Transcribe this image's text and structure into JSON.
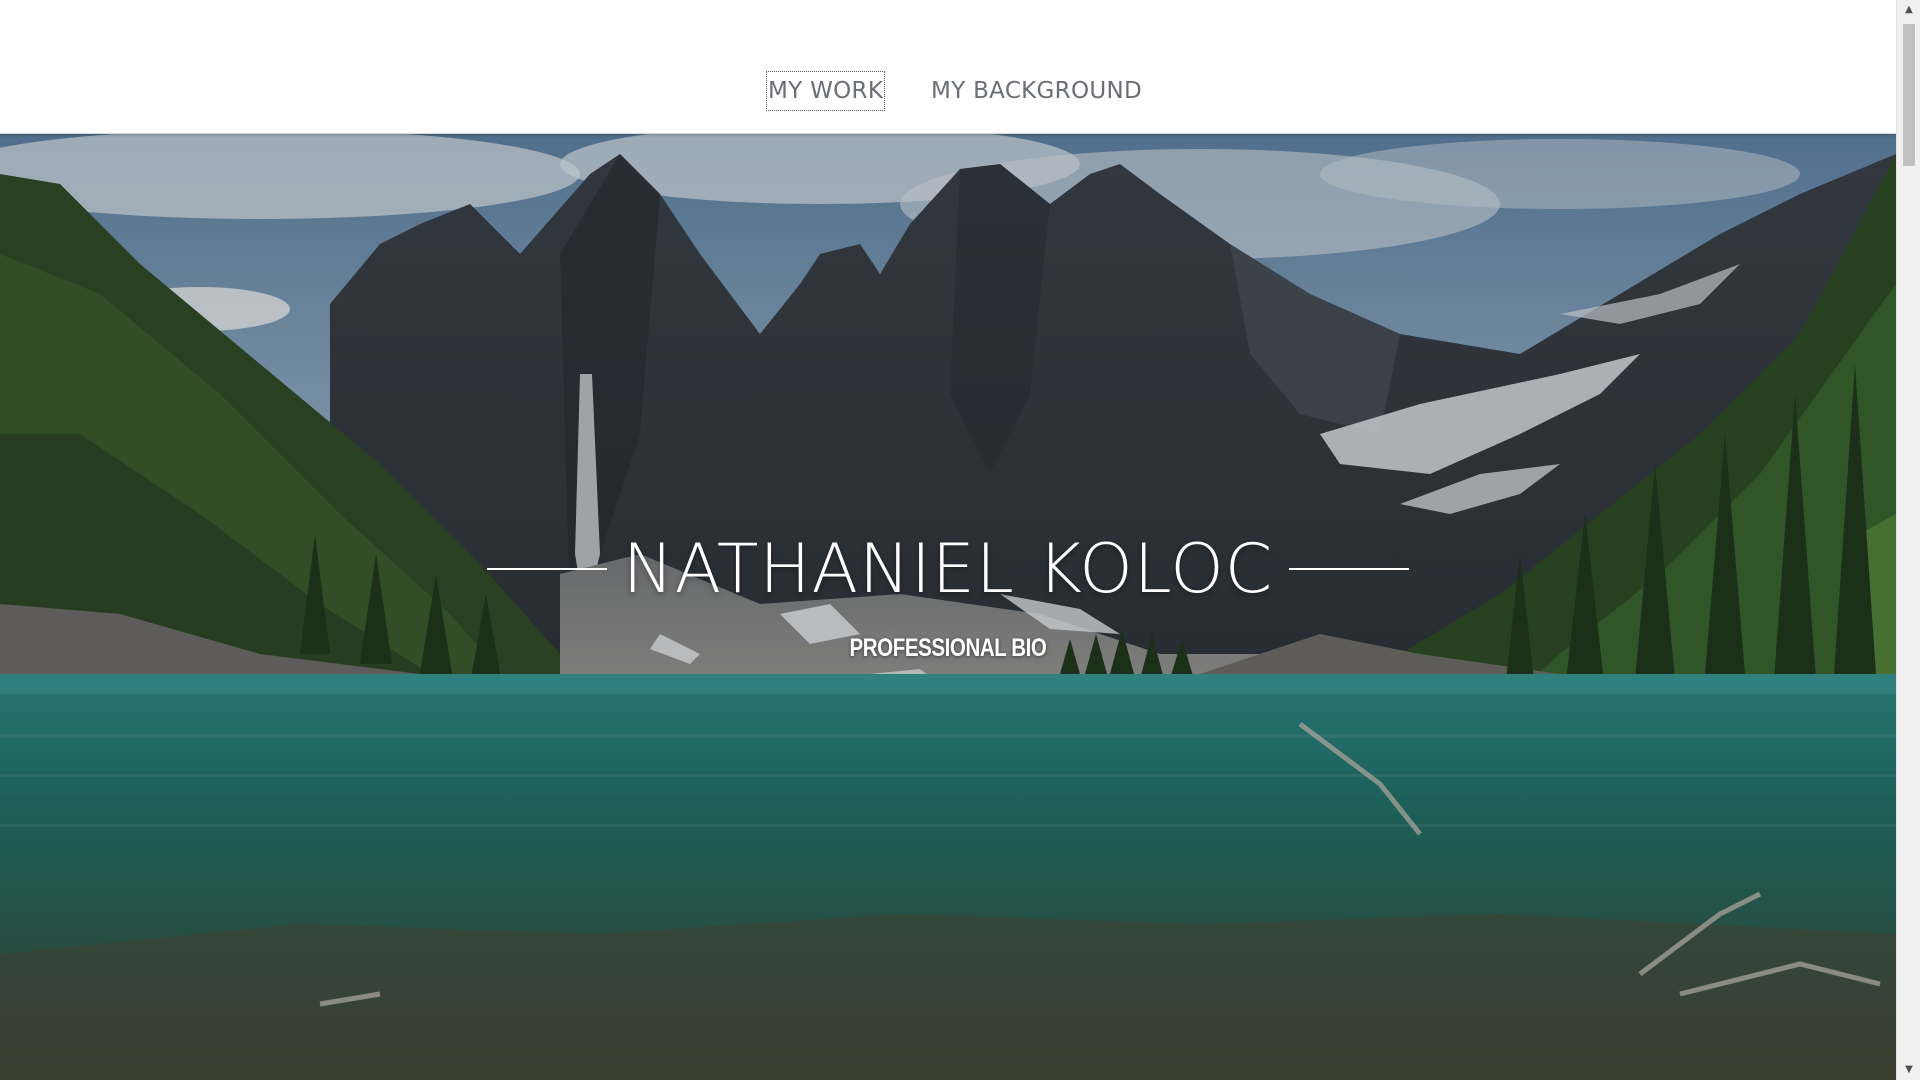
{
  "nav": {
    "items": [
      {
        "label": "MY WORK",
        "focused": true
      },
      {
        "label": "MY BACKGROUND",
        "focused": false
      }
    ]
  },
  "hero": {
    "title": "NATHANIEL KOLOC",
    "subtitle": "PROFESSIONAL BIO",
    "image": "mountain-lake-landscape"
  },
  "scrollbar": {
    "up_icon": "▲",
    "down_icon": "▼"
  },
  "colors": {
    "nav_text": "#6b6f74",
    "header_bg": "#ffffff",
    "hero_text": "#ffffff"
  }
}
